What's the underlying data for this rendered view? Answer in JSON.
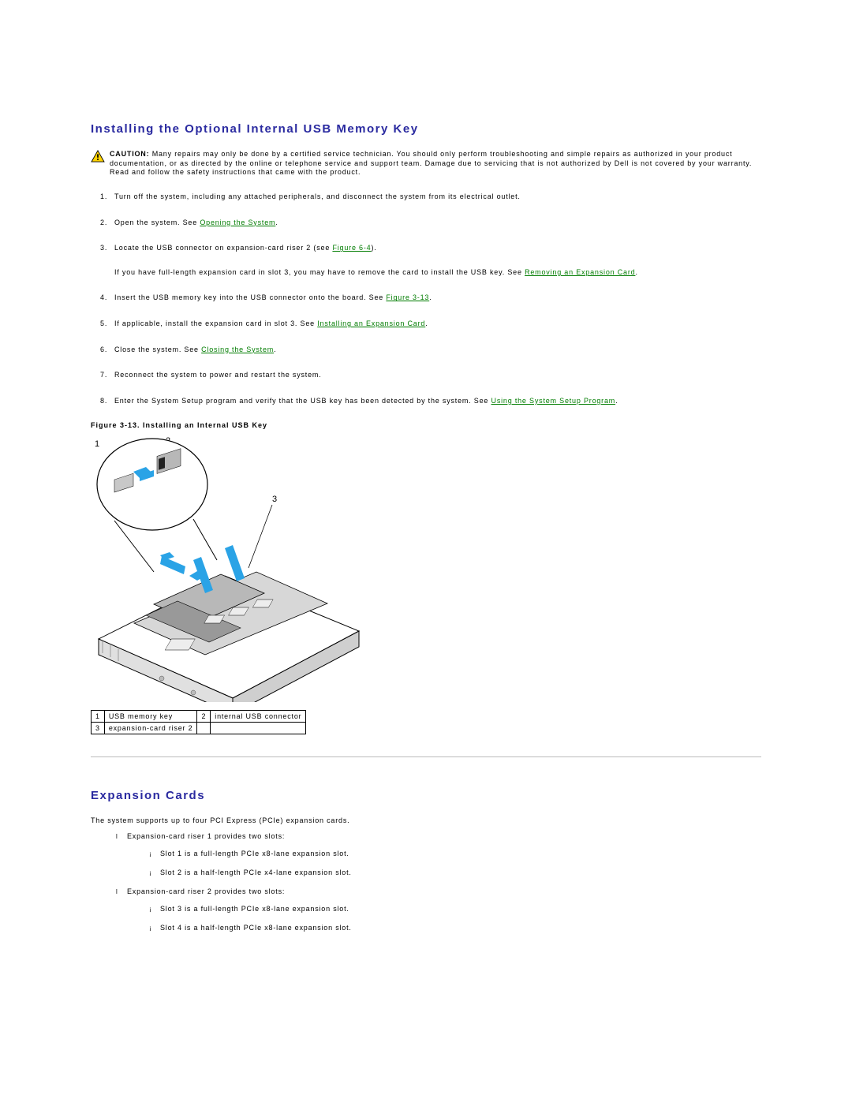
{
  "section1": {
    "title": "Installing the Optional Internal USB Memory Key",
    "caution_label": "CAUTION:",
    "caution_text": " Many repairs may only be done by a certified service technician. You should only perform troubleshooting and simple repairs as authorized in your product documentation, or as directed by the online or telephone service and support team. Damage due to servicing that is not authorized by Dell is not covered by your warranty. Read and follow the safety instructions that came with the product.",
    "steps": {
      "s1": "Turn off the system, including any attached peripherals, and disconnect the system from its electrical outlet.",
      "s2a": "Open the system. See ",
      "s2link": "Opening the System",
      "s2b": ".",
      "s3a": "Locate the USB connector on expansion-card riser 2 (see ",
      "s3link": "Figure 6-4",
      "s3b": ").",
      "s3note_a": "If you have full-length expansion card in slot 3, you may have to remove the card to install the USB key. See ",
      "s3note_link": "Removing an Expansion Card",
      "s3note_b": ".",
      "s4a": "Insert the USB memory key into the USB connector onto the board. See ",
      "s4link": "Figure 3-13",
      "s4b": ".",
      "s5a": "If applicable, install the expansion card in slot 3. See ",
      "s5link": "Installing an Expansion Card",
      "s5b": ".",
      "s6a": "Close the system. See ",
      "s6link": "Closing the System",
      "s6b": ".",
      "s7": "Reconnect the system to power and restart the system.",
      "s8a": "Enter the System Setup program and verify that the USB key has been detected by the system. See ",
      "s8link": "Using the System Setup Program",
      "s8b": "."
    },
    "figure_title": "Figure 3-13. Installing an Internal USB Key",
    "legend": {
      "c1n": "1",
      "c1t": "USB memory key",
      "c2n": "2",
      "c2t": "internal USB connector",
      "c3n": "3",
      "c3t": "expansion-card riser 2"
    }
  },
  "section2": {
    "title": "Expansion Cards",
    "intro": "The system supports up to four PCI Express (PCIe) expansion cards.",
    "r1": "Expansion-card riser 1 provides two slots:",
    "r1s1": "Slot 1 is a full-length PCIe x8-lane expansion slot.",
    "r1s2": "Slot 2 is a half-length PCIe x4-lane expansion slot.",
    "r2": "Expansion-card riser 2 provides two slots:",
    "r2s1": "Slot 3 is a full-length PCIe x8-lane expansion slot.",
    "r2s2": "Slot 4 is a half-length PCIe x8-lane expansion slot."
  }
}
